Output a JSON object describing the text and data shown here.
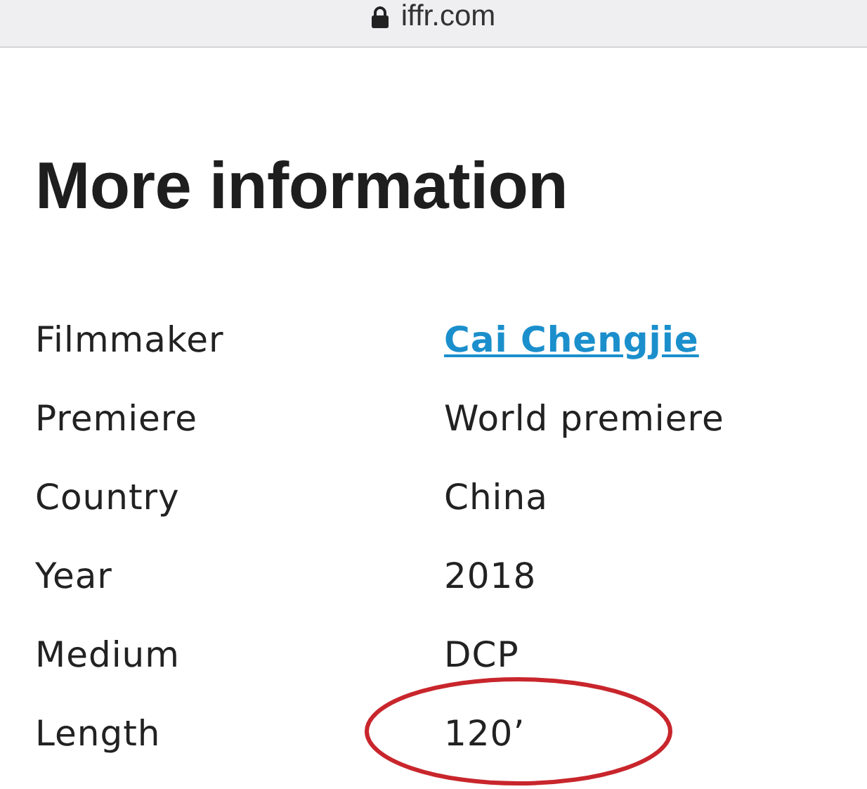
{
  "address_bar": {
    "url": "iffr.com"
  },
  "heading": "More information",
  "details": [
    {
      "label": "Filmmaker",
      "value": "Cai Chengjie",
      "kind": "link"
    },
    {
      "label": "Premiere",
      "value": "World premiere",
      "kind": "text"
    },
    {
      "label": "Country",
      "value": "China",
      "kind": "text"
    },
    {
      "label": "Year",
      "value": "2018",
      "kind": "text"
    },
    {
      "label": "Medium",
      "value": "DCP",
      "kind": "text"
    },
    {
      "label": "Length",
      "value": "120’",
      "kind": "text"
    }
  ]
}
